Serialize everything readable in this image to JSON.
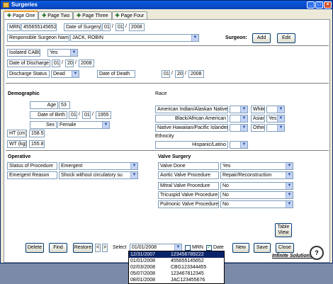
{
  "window": {
    "title": "Surgeries"
  },
  "tabs": [
    {
      "label": "Page One"
    },
    {
      "label": "Page Two"
    },
    {
      "label": "Page Three"
    },
    {
      "label": "Page Four"
    }
  ],
  "header": {
    "mrn_label": "MRN",
    "mrn_value": "455655145652",
    "dos_label": "Date of Surgery",
    "dos_month": "01",
    "dos_day": "01",
    "dos_year": "2008",
    "surgeon_label": "Responsible Surgeon Name",
    "surgeon_value": "JACK, ROBIN",
    "surgeon_title": "Surgeon:",
    "add_label": "Add",
    "edit_label": "Edit"
  },
  "procedure": {
    "isolated_cabg_label": "Isolated CABG",
    "isolated_cabg_value": "Yes",
    "discharge_date_label": "Date of Discharge",
    "discharge_month": "01",
    "discharge_day": "20",
    "discharge_year": "2008",
    "discharge_status_label": "Discharge Status",
    "discharge_status_value": "Dead",
    "death_date_label": "Date of Death",
    "death_month": "01",
    "death_day": "20",
    "death_year": "2008"
  },
  "demographic": {
    "title": "Demographic",
    "age_label": "Age",
    "age_value": "53",
    "dob_label": "Date of Birth",
    "dob_month": "01",
    "dob_day": "01",
    "dob_year": "1955",
    "sex_label": "Sex",
    "sex_value": "Female",
    "ht_label": "HT (cm)",
    "ht_value": "158.5",
    "wt_label": "WT (kg)",
    "wt_value": "155.8"
  },
  "race": {
    "title": "Race",
    "american_indian": "American Indian/Alaskan Native",
    "black": "Black/African American",
    "pacific": "Native Hawaiian/Pacific Islander",
    "white": "White",
    "asian": "Asian",
    "asian_value": "Yes",
    "other": "Other",
    "ethnicity_label": "Ethnicity",
    "ethnicity_value": "Hispanic/Latino"
  },
  "operative": {
    "title": "Operative",
    "status_label": "Status of Procedure",
    "status_value": "Emergent",
    "reason_label": "Emergent Reason",
    "reason_value": "Shock without circulatory su"
  },
  "valve": {
    "title": "Valve Surgery",
    "done_label": "Valve Done",
    "done_value": "Yes",
    "aortic_label": "Aortic Valve Procedure",
    "aortic_value": "Repair/Reconstruction",
    "mitral_label": "Mitral Valve Procedure",
    "mitral_value": "No",
    "tricuspid_label": "Tricuspid Valve Procedure",
    "tricuspid_value": "No",
    "pulmonic_label": "Pulmonic Valve Procedure",
    "pulmonic_value": "No"
  },
  "footer": {
    "table_view_line1": "Table",
    "table_view_line2": "View",
    "delete_label": "Delete",
    "find_label": "Find",
    "restore_label": "Restore",
    "prev_label": "<",
    "next_label": ">",
    "select_label": "Select",
    "select_value": "01/01/2008",
    "mrn_check_label": "MRN",
    "date_check_label": "Date",
    "new_label": "New",
    "save_label": "Save",
    "close_label": "Close",
    "logo_text": "Infinite Solutions"
  },
  "dropdown_rows": [
    {
      "date": "12/31/2007",
      "mrn": "123456789222"
    },
    {
      "date": "01/01/2008",
      "mrn": "455655145652"
    },
    {
      "date": "02/03/2008",
      "mrn": "CBG123344455"
    },
    {
      "date": "05/07/2008",
      "mrn": "123467812345"
    },
    {
      "date": "08/01/2008",
      "mrn": "JAC123455676"
    }
  ]
}
